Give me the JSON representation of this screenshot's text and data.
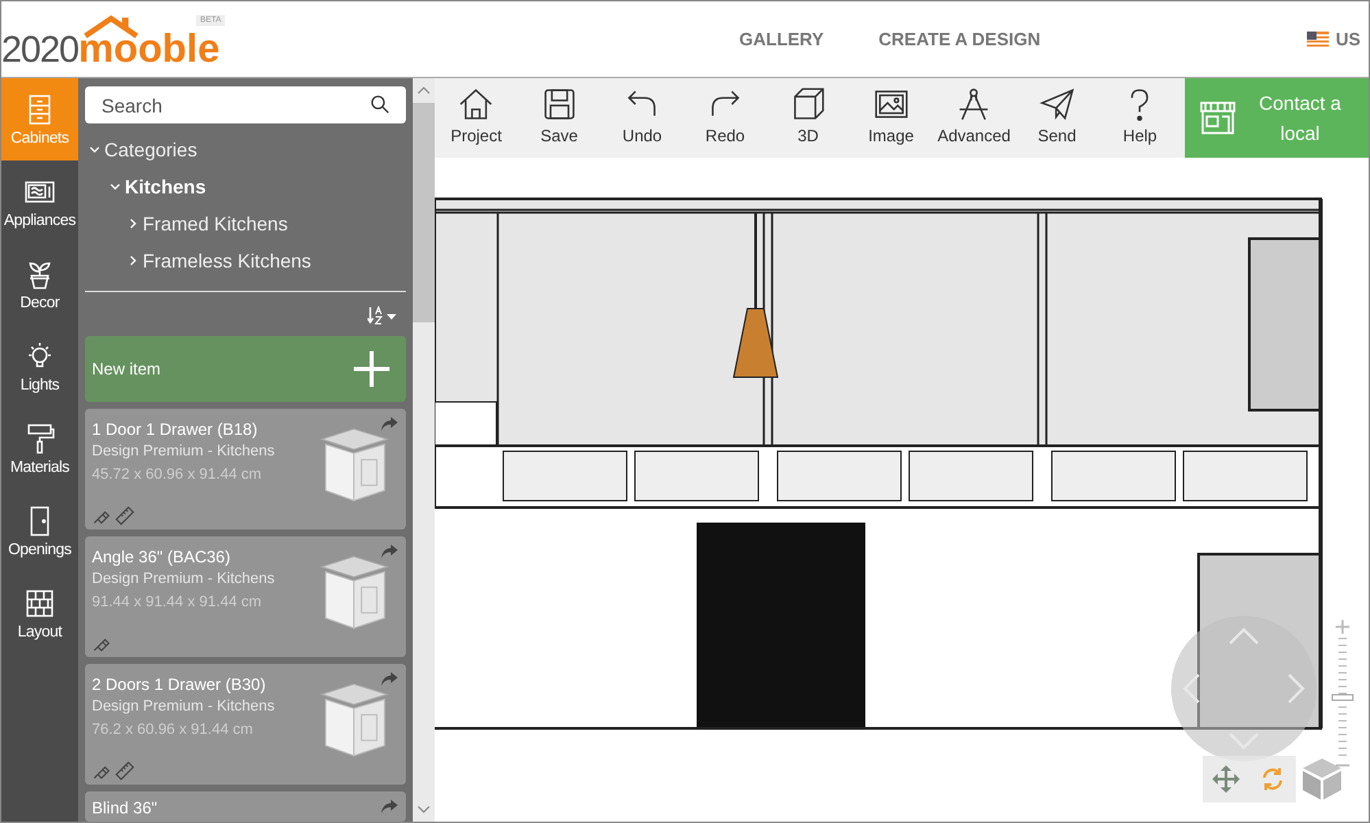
{
  "header": {
    "logo_number": "2020",
    "logo_word": "mooble",
    "beta": "BETA",
    "nav": [
      "GALLERY",
      "CREATE A DESIGN"
    ],
    "locale": "US"
  },
  "rail": [
    {
      "label": "Cabinets",
      "selected": true
    },
    {
      "label": "Appliances",
      "selected": false
    },
    {
      "label": "Decor",
      "selected": false
    },
    {
      "label": "Lights",
      "selected": false
    },
    {
      "label": "Materials",
      "selected": false
    },
    {
      "label": "Openings",
      "selected": false
    },
    {
      "label": "Layout",
      "selected": false
    }
  ],
  "search": {
    "placeholder": "Search"
  },
  "categories": {
    "label": "Categories",
    "expanded": true,
    "children": [
      {
        "label": "Kitchens",
        "expanded": true,
        "children": [
          {
            "label": "Framed Kitchens",
            "expanded": false
          },
          {
            "label": "Frameless Kitchens",
            "expanded": false
          }
        ]
      }
    ]
  },
  "new_item": "New item",
  "products": [
    {
      "name": "1 Door 1 Drawer (B18)",
      "collection": "Design Premium - Kitchens",
      "size": "45.72 x 60.96 x 91.44 cm",
      "resizable": true
    },
    {
      "name": "Angle 36\" (BAC36)",
      "collection": "Design Premium - Kitchens",
      "size": "91.44 x 91.44 x 91.44 cm",
      "resizable": false
    },
    {
      "name": "2 Doors 1 Drawer (B30)",
      "collection": "Design Premium - Kitchens",
      "size": "76.2 x 60.96 x 91.44 cm",
      "resizable": true
    },
    {
      "name": "Blind 36\""
    }
  ],
  "toolbar": [
    "Project",
    "Save",
    "Undo",
    "Redo",
    "3D",
    "Image",
    "Advanced",
    "Send",
    "Help"
  ],
  "contact": "Contact a local",
  "zoom": {
    "level": 0.5
  }
}
